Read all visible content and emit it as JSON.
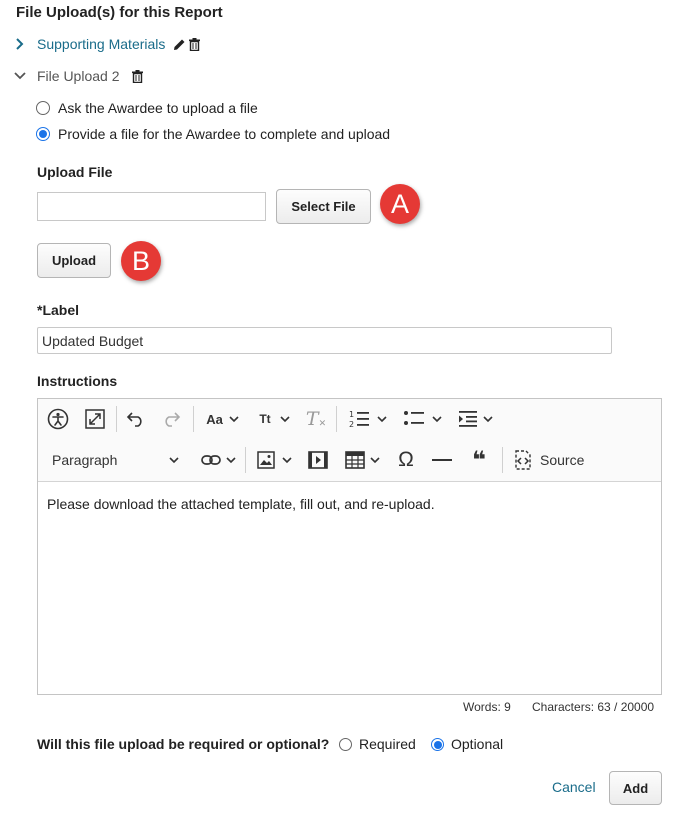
{
  "section": {
    "title": "File Upload(s) for this Report"
  },
  "tree": {
    "item1": {
      "label": "Supporting Materials",
      "expanded": false,
      "icons": [
        "chevron-right-icon",
        "pencil-icon",
        "trash-icon"
      ]
    },
    "item2": {
      "label": "File Upload 2",
      "expanded": true,
      "icons": [
        "chevron-down-icon",
        "trash-icon"
      ]
    }
  },
  "upload_mode": {
    "options": [
      {
        "label": "Ask the Awardee to upload a file",
        "selected": false
      },
      {
        "label": "Provide a file for the Awardee to complete and upload",
        "selected": true
      }
    ]
  },
  "upload_file": {
    "heading": "Upload File",
    "file_name": "",
    "select_button": "Select File",
    "upload_button": "Upload"
  },
  "callouts": {
    "a": "A",
    "b": "B"
  },
  "label_field": {
    "label": "*Label",
    "value": "Updated Budget"
  },
  "instructions": {
    "label": "Instructions",
    "toolbar": {
      "row1": [
        "accessibility-icon",
        "fullscreen-icon",
        "undo-icon",
        "redo-icon",
        "font-size-icon",
        "text-case-icon",
        "clear-format-icon",
        "numbered-list-icon",
        "bulleted-list-icon",
        "indent-icon"
      ],
      "font_size_text": "Aa",
      "text_case_text": "Tt",
      "clear_format_text": "T",
      "paragraph_select": "Paragraph",
      "row2": [
        "link-icon",
        "image-icon",
        "media-icon",
        "table-icon",
        "omega-icon",
        "horizontal-line-icon",
        "quote-icon",
        "source-icon"
      ],
      "omega_text": "Ω",
      "quote_text": "❝",
      "source_label": "Source"
    },
    "content": "Please download the attached template, fill out, and re-upload.",
    "words_text": "Words: 9",
    "characters_text": "Characters: 63 / 20000"
  },
  "requirement": {
    "question": "Will this file upload be required or optional?",
    "options": [
      {
        "label": "Required",
        "selected": false
      },
      {
        "label": "Optional",
        "selected": true
      }
    ]
  },
  "actions": {
    "cancel": "Cancel",
    "add": "Add"
  },
  "colors": {
    "link": "#1a6c8a",
    "radio_accent": "#1a73e8",
    "callout": "#e53935"
  }
}
